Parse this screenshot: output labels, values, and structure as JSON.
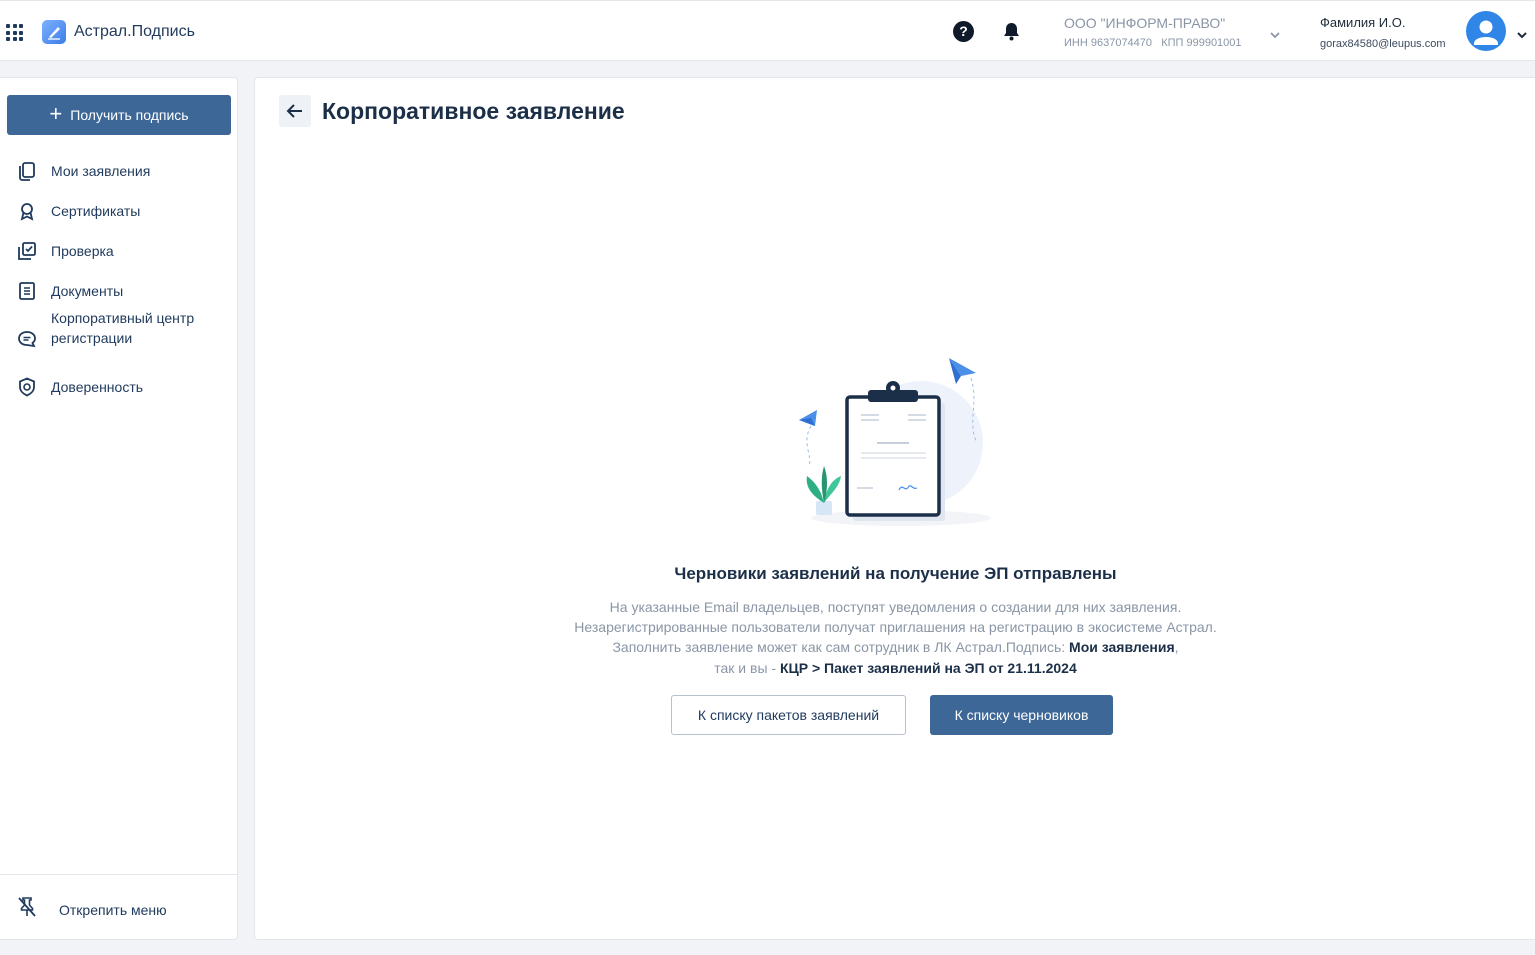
{
  "header": {
    "app_title": "Астрал.Подпись",
    "org_name": "ООО \"ИНФОРМ-ПРАВО\"",
    "org_details": "ИНН 9637074470   КПП 999901001",
    "user_name": "Фамилия И.О.",
    "user_email": "gorax84580@leupus.com",
    "help_glyph": "?"
  },
  "sidebar": {
    "primary_button": "Получить подпись",
    "items": [
      {
        "label": "Мои заявления",
        "icon": "copy-icon"
      },
      {
        "label": "Сертификаты",
        "icon": "award-icon"
      },
      {
        "label": "Проверка",
        "icon": "check-square-icon"
      },
      {
        "label": "Документы",
        "icon": "document-icon"
      },
      {
        "label": "Корпоративный центр регистрации",
        "icon": "chat-icon"
      },
      {
        "label": "Доверенность",
        "icon": "shield-icon"
      }
    ],
    "unpin_label": "Открепить меню"
  },
  "main": {
    "title": "Корпоративное заявление",
    "success_title": "Черновики заявлений на получение ЭП отправлены",
    "line1": "На указанные Email владельцев, поступят уведомления о создании для них заявления.",
    "line2": "Незарегистрированные пользователи получат приглашения на регистрацию в экосистеме Астрал.",
    "line3_prefix": "Заполнить заявление может как сам сотрудник в ЛК Астрал.Подпись: ",
    "line3_link": "Мои заявления",
    "line3_suffix": ",",
    "line4_prefix": "так и вы - ",
    "line4_link": "КЦР > Пакет заявлений на ЭП от 21.11.2024",
    "btn_packages": "К списку пакетов заявлений",
    "btn_drafts": "К списку черновиков"
  },
  "colors": {
    "primary": "#3d6796",
    "title": "#1c2f48",
    "muted": "#8a96a6",
    "avatar": "#2f86e6"
  }
}
